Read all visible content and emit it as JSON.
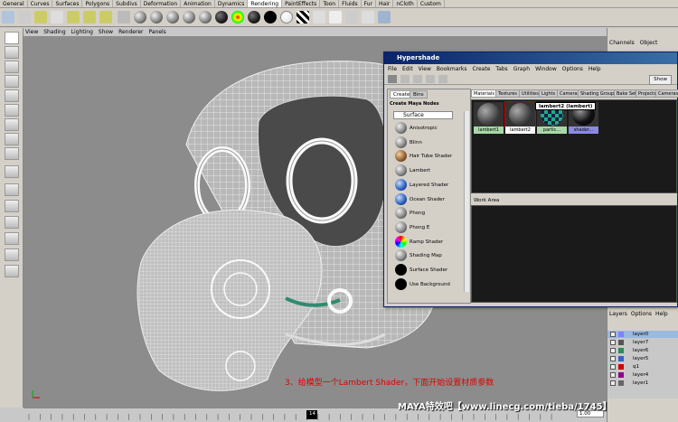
{
  "shelf_tabs": [
    {
      "label": "General",
      "active": false
    },
    {
      "label": "Curves",
      "active": false
    },
    {
      "label": "Surfaces",
      "active": false
    },
    {
      "label": "Polygons",
      "active": false
    },
    {
      "label": "Subdivs",
      "active": false
    },
    {
      "label": "Deformation",
      "active": false
    },
    {
      "label": "Animation",
      "active": false
    },
    {
      "label": "Dynamics",
      "active": false
    },
    {
      "label": "Rendering",
      "active": true
    },
    {
      "label": "PaintEffects",
      "active": false
    },
    {
      "label": "Toon",
      "active": false
    },
    {
      "label": "Fluids",
      "active": false
    },
    {
      "label": "Fur",
      "active": false
    },
    {
      "label": "Hair",
      "active": false
    },
    {
      "label": "nCloth",
      "active": false
    },
    {
      "label": "Custom",
      "active": false
    }
  ],
  "viewport": {
    "menu": [
      "View",
      "Shading",
      "Lighting",
      "Show",
      "Renderer",
      "Panels"
    ],
    "model_bg": "#8c8c8c"
  },
  "channels": {
    "menu": [
      "Channels",
      "Object"
    ]
  },
  "layers": {
    "menu": [
      "Layers",
      "Options",
      "Help"
    ],
    "items": [
      {
        "label": "layer0",
        "color": "#8080ff",
        "selected": true
      },
      {
        "label": "layer7",
        "color": "#555555",
        "selected": false
      },
      {
        "label": "layer6",
        "color": "#2e8b57",
        "selected": false
      },
      {
        "label": "layer5",
        "color": "#3a5fcd",
        "selected": false
      },
      {
        "label": "q1",
        "color": "#cc0000",
        "selected": false
      },
      {
        "label": "layer4",
        "color": "#8b008b",
        "selected": false
      },
      {
        "label": "layer1",
        "color": "#666666",
        "selected": false
      }
    ]
  },
  "timeline": {
    "current_frame": "14",
    "range_start": "1.00"
  },
  "hypershade": {
    "title": "Hypershade",
    "menu": [
      "File",
      "Edit",
      "View",
      "Bookmarks",
      "Create",
      "Tabs",
      "Graph",
      "Window",
      "Options",
      "Help"
    ],
    "show_button": "Show",
    "left_tabs": [
      "Create",
      "Bins"
    ],
    "create_header": "Create Maya Nodes",
    "surface_header": "Surface",
    "nodes": [
      {
        "label": "Anisotropic",
        "icon": "sphere-gray"
      },
      {
        "label": "Blinn",
        "icon": "sphere-gray"
      },
      {
        "label": "Hair Tube Shader",
        "icon": "sphere-brown"
      },
      {
        "label": "Lambert",
        "icon": "sphere-gray"
      },
      {
        "label": "Layered Shader",
        "icon": "sphere-blue"
      },
      {
        "label": "Ocean Shader",
        "icon": "sphere-blue"
      },
      {
        "label": "Phong",
        "icon": "sphere-gray"
      },
      {
        "label": "Phong E",
        "icon": "sphere-gray"
      },
      {
        "label": "Ramp Shader",
        "icon": "sphere-rainbow"
      },
      {
        "label": "Shading Map",
        "icon": "sphere-gray"
      },
      {
        "label": "Surface Shader",
        "icon": "sphere-black"
      },
      {
        "label": "Use Background",
        "icon": "sphere-black"
      }
    ],
    "right_tabs": [
      "Materials",
      "Textures",
      "Utilities",
      "Lights",
      "Cameras",
      "Shading Groups",
      "Bake Sets",
      "Projects",
      "Cameras"
    ],
    "materials": [
      {
        "label": "lambert1",
        "selected": false,
        "ball": "gray"
      },
      {
        "label": "lambert2",
        "selected": true,
        "ball": "gray"
      },
      {
        "label": "partic...",
        "selected": false,
        "ball": "checker"
      },
      {
        "label": "shader...",
        "selected": false,
        "ball": "black"
      }
    ],
    "tooltip": "lambert2 (lambert)",
    "work_area_label": "Work Area"
  },
  "caption_cn": "3、给模型一个Lambert Shader，下面开始设置材质参数",
  "watermark": "MAYA特效吧【www.linecg.com/tieba/1745】"
}
